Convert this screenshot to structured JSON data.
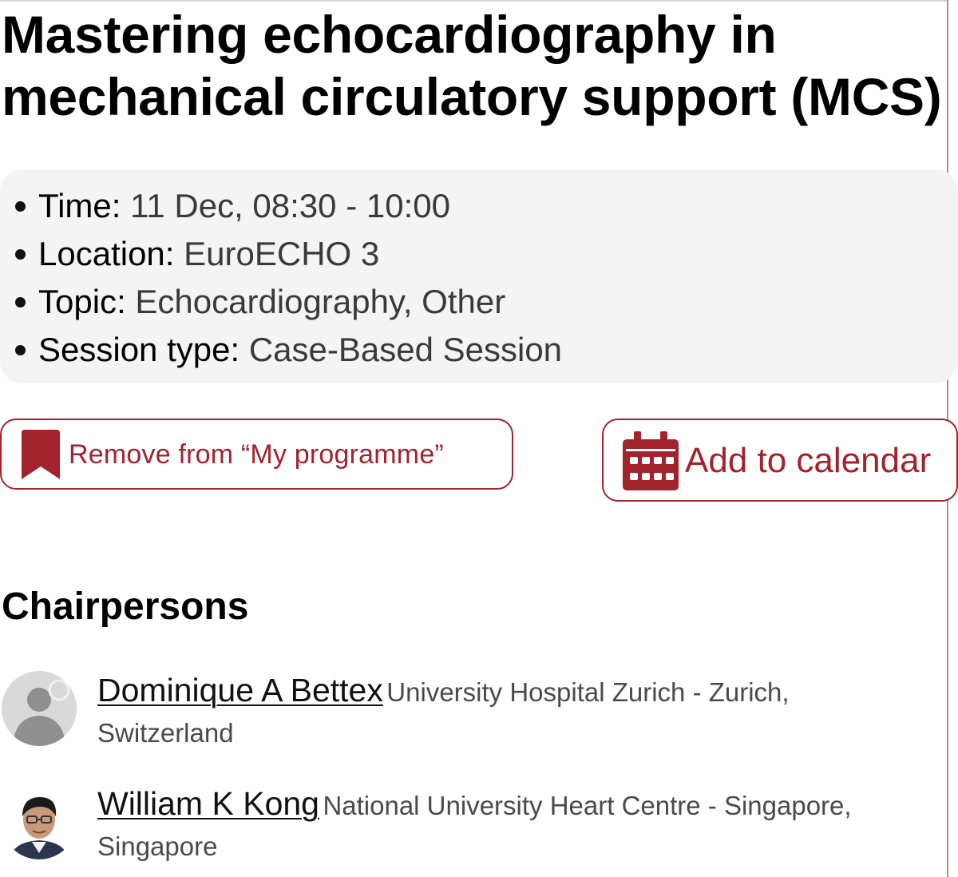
{
  "session": {
    "title": "Mastering echocardiography in mechanical circulatory support (MCS)"
  },
  "details": [
    {
      "label": "Time",
      "value": "11 Dec, 08:30 - 10:00"
    },
    {
      "label": "Location",
      "value": "EuroECHO 3"
    },
    {
      "label": "Topic",
      "value": "Echocardiography, Other"
    },
    {
      "label": "Session type",
      "value": "Case-Based Session"
    }
  ],
  "actions": {
    "remove_label": "Remove from “My programme”",
    "calendar_label": "Add to calendar",
    "remove_icon": "bookmark-icon",
    "calendar_icon": "calendar-icon"
  },
  "chairpersons": {
    "heading": "Chairpersons",
    "people": [
      {
        "name": "Dominique A Bettex",
        "affiliation": "University Hospital Zurich - Zurich, Switzerland"
      },
      {
        "name": "William K Kong",
        "affiliation": "National University Heart Centre - Singapore, Singapore"
      }
    ]
  },
  "colors": {
    "accent": "#a3232c",
    "info_background": "#f4f4f4"
  }
}
